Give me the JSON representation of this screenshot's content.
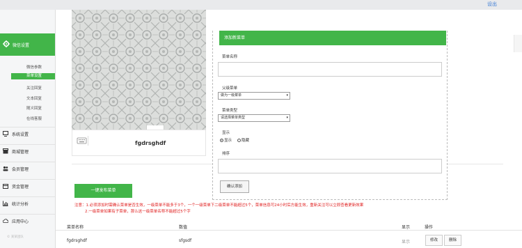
{
  "topbar": {
    "logout": "设出"
  },
  "sidebar": {
    "active_section": "微信设置",
    "sub_items": [
      "微信参数",
      "菜单设置",
      "关注回复",
      "文本回复",
      "随义回复",
      "在线客服"
    ],
    "active_sub_index": 1,
    "nav_items": [
      "系统设置",
      "商城管理",
      "会员管理",
      "资金管理",
      "统计分析",
      "应用中心"
    ],
    "footer": "© 某某团队"
  },
  "preview": {
    "menu_name": "fgdrsghdf"
  },
  "add_panel": {
    "title": "添加新菜单",
    "name_label": "菜单名称",
    "name_value": "",
    "parent_label": "父级菜单",
    "parent_selected": "做为一级菜单",
    "type_label": "菜单类型",
    "type_selected": "请选择菜单类型",
    "show_label": "显示",
    "show_yes": "显示",
    "show_no": "隐藏",
    "sort_label": "排序",
    "sort_value": "",
    "confirm": "确认添加"
  },
  "publish_button": "一键发布菜单",
  "notes": [
    "注意：1.必须添加时需确认菜单是否生效，一级菜单不能多于3个，一个一级菜单下二级菜单不能超过5个，菜单信息可24小时后方能生效，重新关注可以立即查看更新效果",
    "2.一级菜单如果有子菜单，那么这一级菜单名称不能超过5个字"
  ],
  "table": {
    "headers": [
      "菜单名称",
      "数值",
      "显示",
      "操作"
    ],
    "rows": [
      {
        "name": "fgdrsghdf",
        "value": "sfgsdf",
        "show": "显示",
        "edit": "修改",
        "delete": "删除"
      }
    ]
  },
  "colors": {
    "accent": "#42b549",
    "warning": "#e02020",
    "link": "#3a7bd5"
  }
}
